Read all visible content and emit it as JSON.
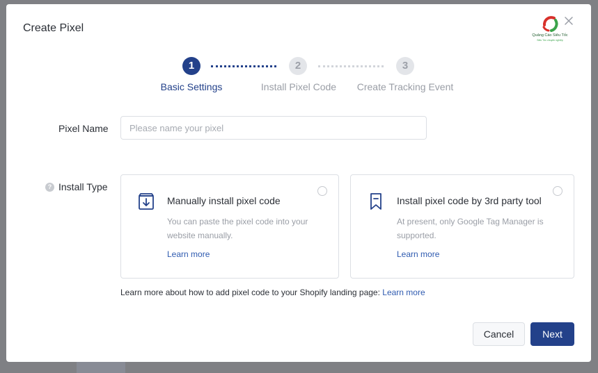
{
  "modal": {
    "title": "Create Pixel",
    "watermark": {
      "name": "Quảng Cáo Siêu Tốc",
      "tagline": "Siêu Tốc chuyên nghiệp"
    }
  },
  "steps": [
    {
      "number": "1",
      "label": "Basic Settings",
      "state": "active"
    },
    {
      "number": "2",
      "label": "Install Pixel Code",
      "state": "inactive"
    },
    {
      "number": "3",
      "label": "Create Tracking Event",
      "state": "inactive"
    }
  ],
  "form": {
    "pixel_name": {
      "label": "Pixel Name",
      "value": "",
      "placeholder": "Please name your pixel"
    },
    "install_type": {
      "label": "Install Type",
      "help_glyph": "?",
      "options": [
        {
          "title": "Manually install pixel code",
          "description": "You can paste the pixel code into your website manually.",
          "link": "Learn more",
          "icon": "download-box-icon"
        },
        {
          "title": "Install pixel code by 3rd party tool",
          "description": "At present, only Google Tag Manager is supported.",
          "link": "Learn more",
          "icon": "bookmark-icon"
        }
      ]
    },
    "footnote": {
      "text": "Learn more about how to add pixel code to your Shopify landing page: ",
      "link": "Learn more"
    }
  },
  "buttons": {
    "cancel": "Cancel",
    "next": "Next"
  },
  "colors": {
    "primary": "#23418a",
    "link": "#2f5bb0",
    "overlay": "#7f8084",
    "inactive_step": "#e3e5e9"
  }
}
